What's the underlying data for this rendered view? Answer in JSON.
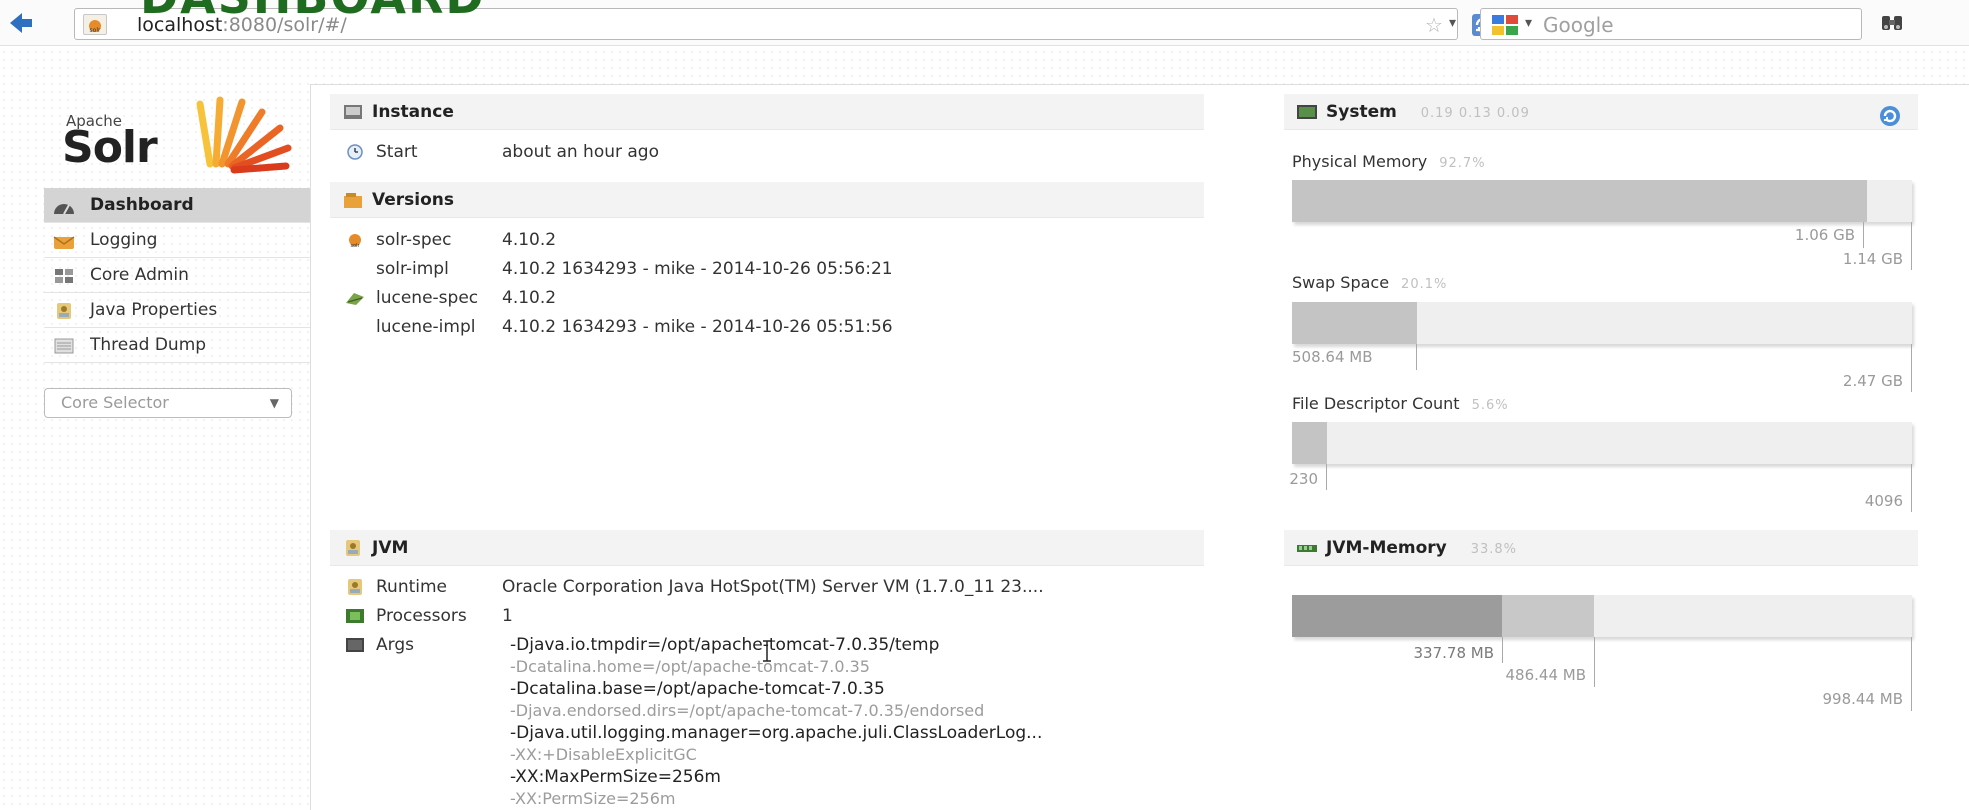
{
  "overlay_title": "DASHBOARD",
  "browser": {
    "url_host": "localhost",
    "url_rest": ":8080/solr/#/",
    "search_placeholder": "Google"
  },
  "logo": {
    "apache": "Apache",
    "solr": "Solr"
  },
  "sidebar": {
    "items": [
      {
        "label": "Dashboard",
        "icon": "dashboard-icon",
        "active": true
      },
      {
        "label": "Logging",
        "icon": "logging-icon"
      },
      {
        "label": "Core Admin",
        "icon": "core-admin-icon"
      },
      {
        "label": "Java Properties",
        "icon": "java-properties-icon"
      },
      {
        "label": "Thread Dump",
        "icon": "thread-dump-icon"
      }
    ],
    "core_selector": "Core Selector"
  },
  "instance": {
    "title": "Instance",
    "start_label": "Start",
    "start_value": "about an hour ago"
  },
  "versions": {
    "title": "Versions",
    "rows": [
      {
        "label": "solr-spec",
        "value": "4.10.2"
      },
      {
        "label": "solr-impl",
        "value": "4.10.2 1634293 - mike - 2014-10-26 05:56:21"
      },
      {
        "label": "lucene-spec",
        "value": "4.10.2"
      },
      {
        "label": "lucene-impl",
        "value": "4.10.2 1634293 - mike - 2014-10-26 05:51:56"
      }
    ]
  },
  "jvm": {
    "title": "JVM",
    "runtime_label": "Runtime",
    "runtime_value": "Oracle Corporation Java HotSpot(TM) Server VM (1.7.0_11 23....",
    "processors_label": "Processors",
    "processors_value": "1",
    "args_label": "Args",
    "args": [
      "-Djava.io.tmpdir=/opt/apache-tomcat-7.0.35/temp",
      "-Dcatalina.home=/opt/apache-tomcat-7.0.35",
      "-Dcatalina.base=/opt/apache-tomcat-7.0.35",
      "-Djava.endorsed.dirs=/opt/apache-tomcat-7.0.35/endorsed",
      "-Djava.util.logging.manager=org.apache.juli.ClassLoaderLog...",
      "-XX:+DisableExplicitGC",
      "-XX:MaxPermSize=256m",
      "-XX:PermSize=256m"
    ]
  },
  "system": {
    "title": "System",
    "load": "0.19  0.13  0.09",
    "physical_memory": {
      "label": "Physical Memory",
      "percent": "92.7%",
      "used": "1.06 GB",
      "total": "1.14 GB",
      "fill": 0.927
    },
    "swap_space": {
      "label": "Swap Space",
      "percent": "20.1%",
      "used": "508.64 MB",
      "total": "2.47 GB",
      "fill": 0.201
    },
    "file_descriptor": {
      "label": "File Descriptor Count",
      "percent": "5.6%",
      "used": "230",
      "total": "4096",
      "fill": 0.056
    }
  },
  "jvm_memory": {
    "title": "JVM-Memory",
    "percent": "33.8%",
    "used": "337.78 MB",
    "committed": "486.44 MB",
    "max": "998.44 MB",
    "used_fill": 0.338,
    "committed_fill": 0.487
  },
  "colors": {
    "title_green": "#1f6b1f",
    "bar_track": "#efefef",
    "bar_fill": "#c4c4c4",
    "bar_dark": "#9c9c9c"
  }
}
